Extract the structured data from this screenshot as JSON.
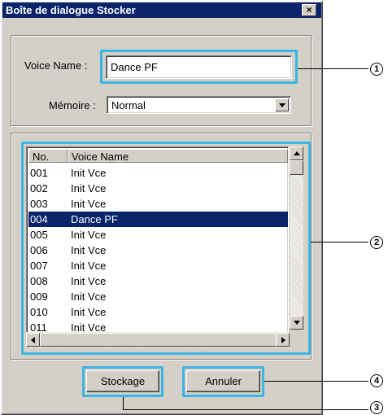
{
  "window": {
    "title": "Boîte de dialogue Stocker",
    "close_glyph": "×"
  },
  "voice_name": {
    "label": "Voice Name :",
    "value": "Dance PF"
  },
  "memory": {
    "label": "Mémoire :",
    "selected": "Normal"
  },
  "list": {
    "columns": [
      "No.",
      "Voice Name"
    ],
    "rows": [
      {
        "no": "001",
        "name": "Init Vce"
      },
      {
        "no": "002",
        "name": "Init Vce"
      },
      {
        "no": "003",
        "name": "Init Vce"
      },
      {
        "no": "004",
        "name": "Dance PF"
      },
      {
        "no": "005",
        "name": "Init Vce"
      },
      {
        "no": "006",
        "name": "Init Vce"
      },
      {
        "no": "007",
        "name": "Init Vce"
      },
      {
        "no": "008",
        "name": "Init Vce"
      },
      {
        "no": "009",
        "name": "Init Vce"
      },
      {
        "no": "010",
        "name": "Init Vce"
      },
      {
        "no": "011",
        "name": "Init Vce"
      }
    ],
    "selected_index": 3
  },
  "buttons": {
    "store": "Stockage",
    "cancel": "Annuler"
  },
  "callouts": [
    "1",
    "2",
    "3",
    "4"
  ],
  "colors": {
    "highlight": "#3ab6e6",
    "titlebar": "#0a246a",
    "selection": "#0a246a"
  }
}
